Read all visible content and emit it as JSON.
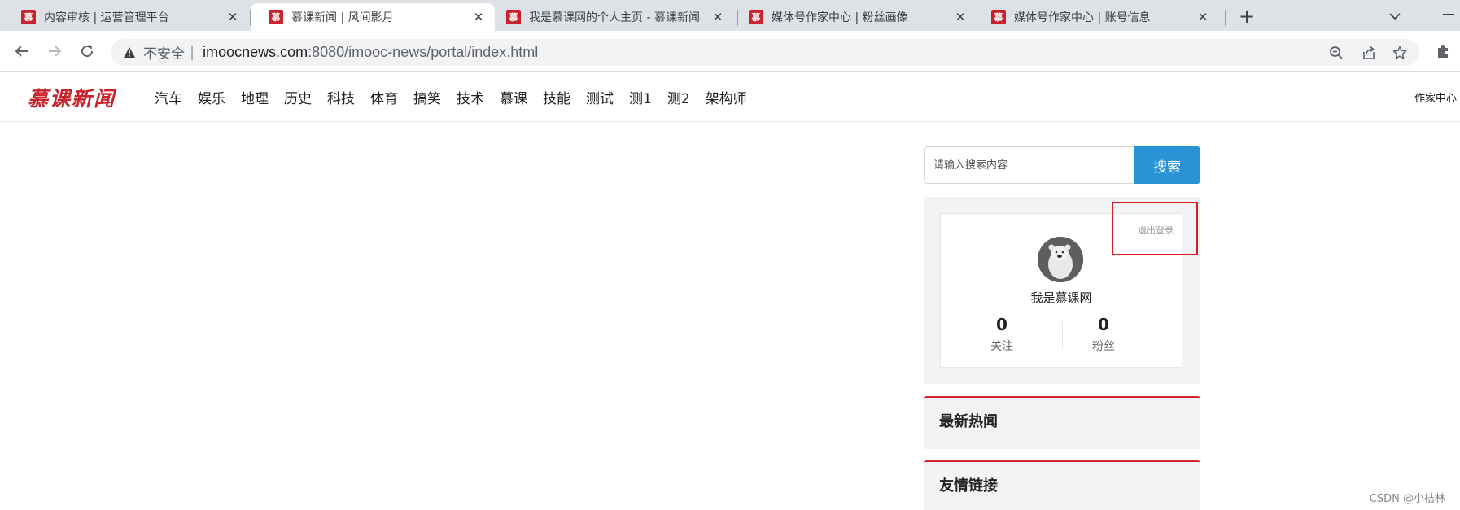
{
  "browser": {
    "tabs": [
      {
        "title": "内容审核 | 运营管理平台",
        "favicon": "慕",
        "active": false
      },
      {
        "title": "慕课新闻 | 风间影月",
        "favicon": "慕",
        "active": true
      },
      {
        "title": "我是慕课网的个人主页 - 慕课新闻",
        "favicon": "慕",
        "active": false
      },
      {
        "title": "媒体号作家中心 | 粉丝画像",
        "favicon": "慕",
        "active": false
      },
      {
        "title": "媒体号作家中心 | 账号信息",
        "favicon": "慕",
        "active": false
      }
    ],
    "security_label": "不安全",
    "url_host": "imoocnews.com",
    "url_rest": ":8080/imooc-news/portal/index.html",
    "icons": [
      "back-icon",
      "forward-icon",
      "reload-icon",
      "warning-icon",
      "zoom-icon",
      "share-icon",
      "star-icon",
      "extensions-icon",
      "new-tab-icon",
      "tab-list-icon",
      "minimize-icon"
    ]
  },
  "site": {
    "logo": "慕课新闻",
    "nav": [
      "汽车",
      "娱乐",
      "地理",
      "历史",
      "科技",
      "体育",
      "搞笑",
      "技术",
      "慕课",
      "技能",
      "测试",
      "测1",
      "测2",
      "架构师"
    ],
    "author_center": "作家中心"
  },
  "sidebar": {
    "search": {
      "placeholder": "请输入搜索内容",
      "button": "搜索"
    },
    "user": {
      "logout": "退出登录",
      "name": "我是慕课网",
      "following_count": "0",
      "following_label": "关注",
      "fans_count": "0",
      "fans_label": "粉丝"
    },
    "hot_news_title": "最新热闻",
    "friend_links_title": "友情链接"
  },
  "watermark": "CSDN @小桔林",
  "colors": {
    "brand_red": "#c8232c",
    "search_blue": "#2a93d6",
    "highlight_red": "#e01b22"
  }
}
